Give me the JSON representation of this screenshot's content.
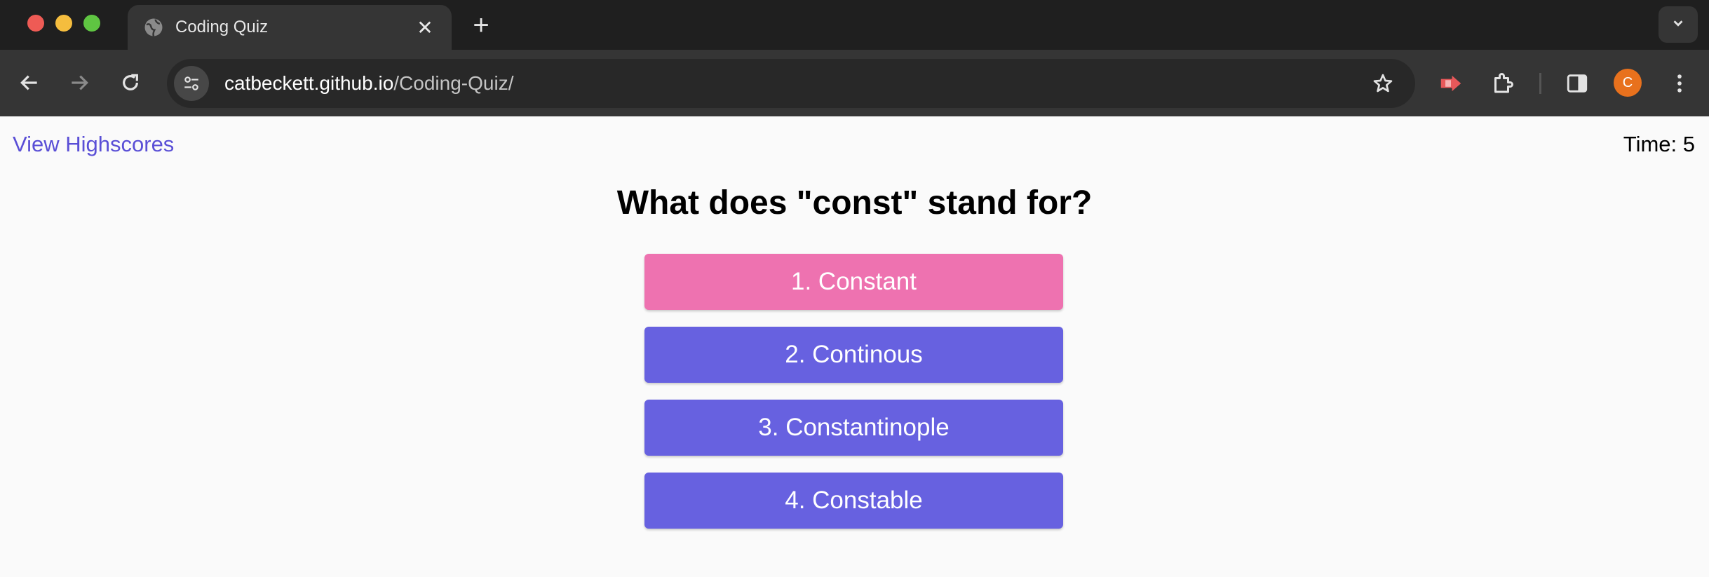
{
  "browser": {
    "tab_title": "Coding Quiz",
    "url_host": "catbeckett.github.io",
    "url_path": "/Coding-Quiz/",
    "profile_initial": "C",
    "colors": {
      "profile": "#e8711d"
    }
  },
  "header": {
    "highscores_label": "View Highscores",
    "timer_text": "Time: 5"
  },
  "quiz": {
    "question": "What does \"const\" stand for?",
    "answers": [
      {
        "label": "1. Constant",
        "highlighted": true
      },
      {
        "label": "2. Continous",
        "highlighted": false
      },
      {
        "label": "3. Constantinople",
        "highlighted": false
      },
      {
        "label": "4. Constable",
        "highlighted": false
      }
    ],
    "colors": {
      "highlight": "#ee72b0",
      "button": "#6761e0",
      "link": "#5a4fd6"
    }
  },
  "icons": [
    "globe-icon",
    "close-icon",
    "plus-icon",
    "chevron-down-icon",
    "back-icon",
    "forward-icon",
    "reload-icon",
    "tune-icon",
    "star-icon",
    "recorder-extension-icon",
    "puzzle-icon",
    "side-panel-icon",
    "more-vert-icon"
  ]
}
